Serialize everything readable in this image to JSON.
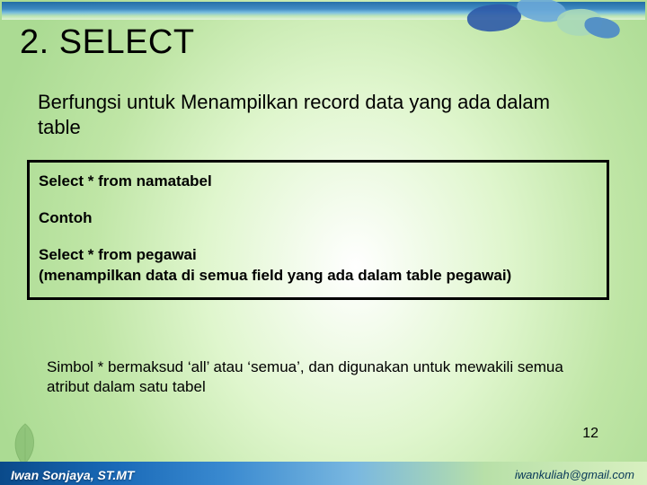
{
  "title": "2.  SELECT",
  "description": "Berfungsi untuk Menampilkan record data yang ada dalam table",
  "code": {
    "line1": "Select * from namatabel",
    "label": "Contoh",
    "line2": "Select * from pegawai",
    "line3": "(menampilkan data di semua field yang ada dalam table pegawai)"
  },
  "note": "Simbol * bermaksud ‘all’ atau ‘semua’, dan digunakan untuk mewakili semua atribut dalam satu tabel",
  "page_number": "12",
  "footer": {
    "author": "Iwan Sonjaya, ST.MT",
    "contact": "iwankuliah@gmail.com"
  }
}
